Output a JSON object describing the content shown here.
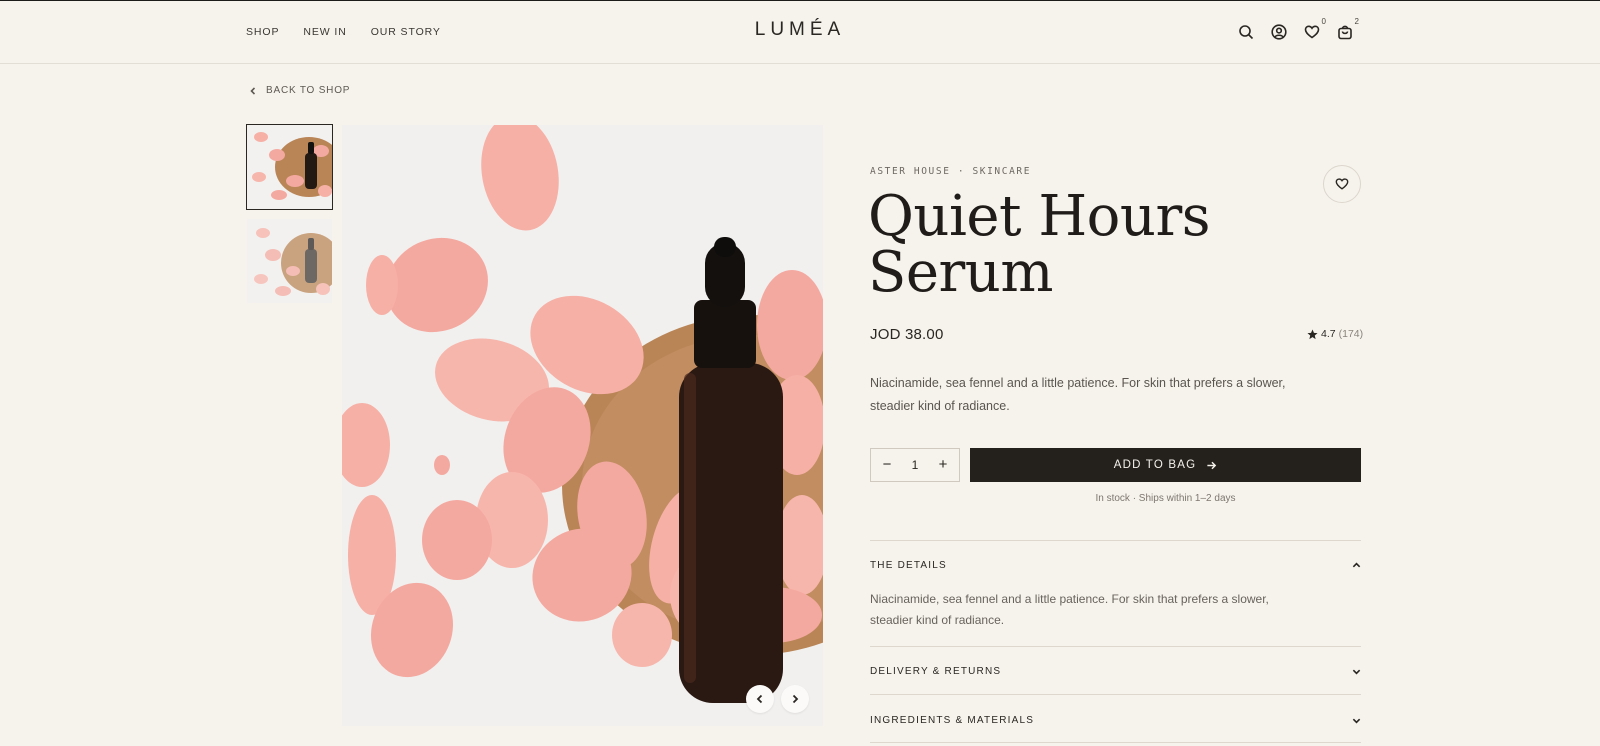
{
  "header": {
    "nav": [
      "SHOP",
      "NEW IN",
      "OUR STORY"
    ],
    "logo": "LUMÉA",
    "wishlist_count": "0",
    "bag_count": "2"
  },
  "back_label": "BACK TO SHOP",
  "product": {
    "brand": "ASTER HOUSE · SKINCARE",
    "title_line1": "Quiet Hours",
    "title_line2": "Serum",
    "price": "JOD 38.00",
    "rating": "4.7",
    "rating_count": "(174)",
    "description": "Niacinamide, sea fennel and a little patience. For skin that prefers a slower, steadier kind of radiance.",
    "quantity": "1",
    "add_label": "ADD TO BAG",
    "stock": "In stock · Ships within 1–2 days"
  },
  "accordion": [
    {
      "label": "THE DETAILS",
      "open": true,
      "body": "Niacinamide, sea fennel and a little patience. For skin that prefers a slower, steadier kind of radiance."
    },
    {
      "label": "DELIVERY & RETURNS",
      "open": false
    },
    {
      "label": "INGREDIENTS & MATERIALS",
      "open": false
    }
  ],
  "colors": {
    "background": "#f6f3ed",
    "text": "#26221e",
    "button": "#24201c",
    "petal": "#f4a9a0",
    "wood": "#b98557"
  },
  "icons": [
    "search-icon",
    "account-icon",
    "heart-icon",
    "bag-icon",
    "chevron-left-icon",
    "chevron-right-icon",
    "star-icon",
    "arrow-right-icon",
    "chevron-up-icon",
    "chevron-down-icon"
  ]
}
